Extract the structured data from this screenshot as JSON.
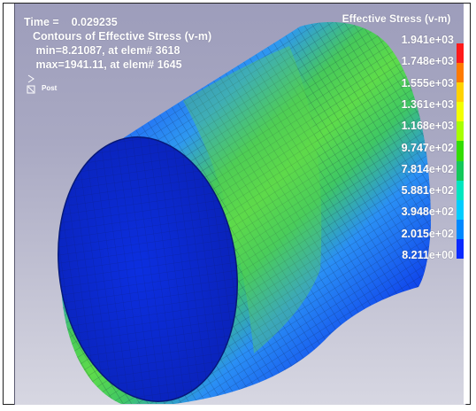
{
  "viewer": {
    "time_line": "Time =    0.029235",
    "contour_title": "Contours of Effective Stress (v-m)",
    "min_line": " min=8.21087, at elem# 3618",
    "max_line": " max=1941.11, at elem# 1645",
    "post_label": "Post"
  },
  "legend": {
    "title": "Effective Stress (v-m)",
    "labels": [
      "1.941e+03",
      "1.748e+03",
      "1.555e+03",
      "1.361e+03",
      "1.168e+03",
      "9.747e+02",
      "7.814e+02",
      "5.881e+02",
      "3.948e+02",
      "2.015e+02",
      "8.211e+00"
    ],
    "colors": [
      "#ff1a1a",
      "#ff7a00",
      "#ffd200",
      "#f3ff00",
      "#a8ff00",
      "#33dd00",
      "#13c85a",
      "#00e6c0",
      "#00ccff",
      "#0088ff",
      "#0a2bff"
    ]
  },
  "model": {
    "colors": {
      "base": "#0a28e0",
      "mid": "#2f8cff",
      "high": "#49d24a",
      "peak": "#9ce43a"
    }
  }
}
